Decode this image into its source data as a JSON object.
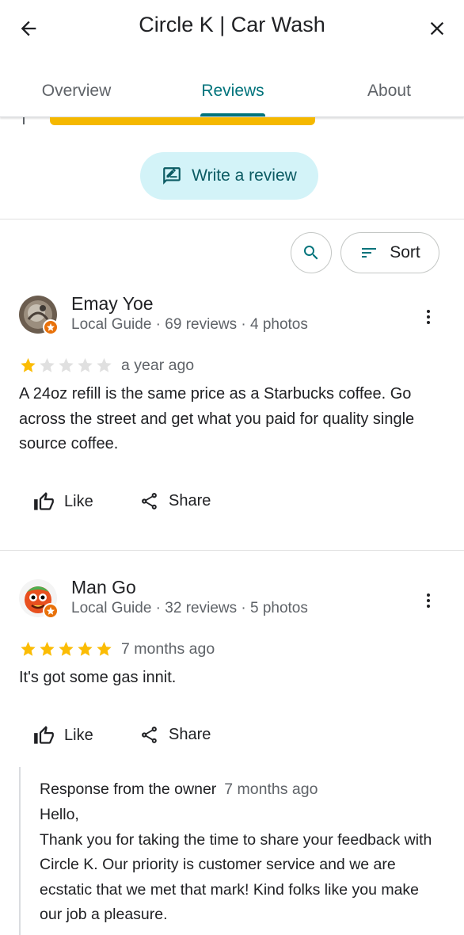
{
  "header": {
    "title": "Circle K | Car Wash",
    "back_icon": "arrow-back-icon",
    "close_icon": "close-icon"
  },
  "tabs": [
    {
      "label": "Overview",
      "active": false
    },
    {
      "label": "Reviews",
      "active": true
    },
    {
      "label": "About",
      "active": false
    }
  ],
  "write_review": {
    "label": "Write a review",
    "icon": "rate-review-icon"
  },
  "toolbar": {
    "search_icon": "search-icon",
    "sort_label": "Sort",
    "sort_icon": "sort-icon"
  },
  "colors": {
    "accent": "#00737b",
    "write_review_bg": "#d3f3f8",
    "star_filled": "#fbbc04",
    "star_empty": "#e0e0e0",
    "guide_badge": "#e8710a"
  },
  "reviews": [
    {
      "author": "Emay Yoe",
      "meta": "Local Guide · 69 reviews · 4 photos",
      "rating": 1,
      "max_rating": 5,
      "date": "a year ago",
      "text": "A 24oz refill is the same price as a Starbucks coffee. Go across the street and  get what you paid for quality single source coffee.",
      "like_label": "Like",
      "share_label": "Share"
    },
    {
      "author": "Man Go",
      "meta": "Local Guide · 32 reviews · 5 photos",
      "rating": 5,
      "max_rating": 5,
      "date": "7 months ago",
      "text": "It's got some gas innit.",
      "like_label": "Like",
      "share_label": "Share",
      "owner_response": {
        "label": "Response from the owner",
        "date": "7 months ago",
        "text": "Hello,\nThank you for taking the time to share your feedback with Circle K. Our priority is customer service and we are ecstatic that we met that mark! Kind folks like you make our job a pleasure."
      }
    }
  ]
}
